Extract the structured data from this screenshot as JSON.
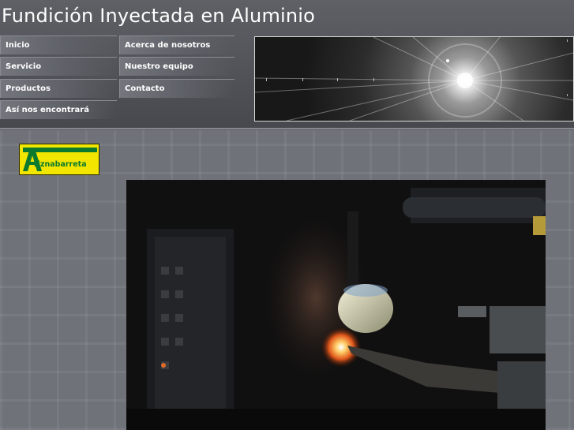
{
  "site": {
    "title": "Fundición Inyectada en Aluminio"
  },
  "nav": {
    "left": [
      "Inicio",
      "Servicio",
      "Productos",
      "Así nos encontrará"
    ],
    "right": [
      "Acerca de nosotros",
      "Nuestro equipo",
      "Contacto"
    ]
  },
  "logo": {
    "text": "riznabarreta"
  },
  "colors": {
    "header_bg": "#4d4e53",
    "page_bg": "#6f7278",
    "logo_yellow": "#f2e600",
    "logo_green": "#0c7a2e",
    "nav_text": "#ffffff"
  },
  "images": {
    "banner": "light-burst-banner",
    "photo": "foundry-machine-ladle-photo",
    "logo": "arriznabarreta-logo"
  }
}
